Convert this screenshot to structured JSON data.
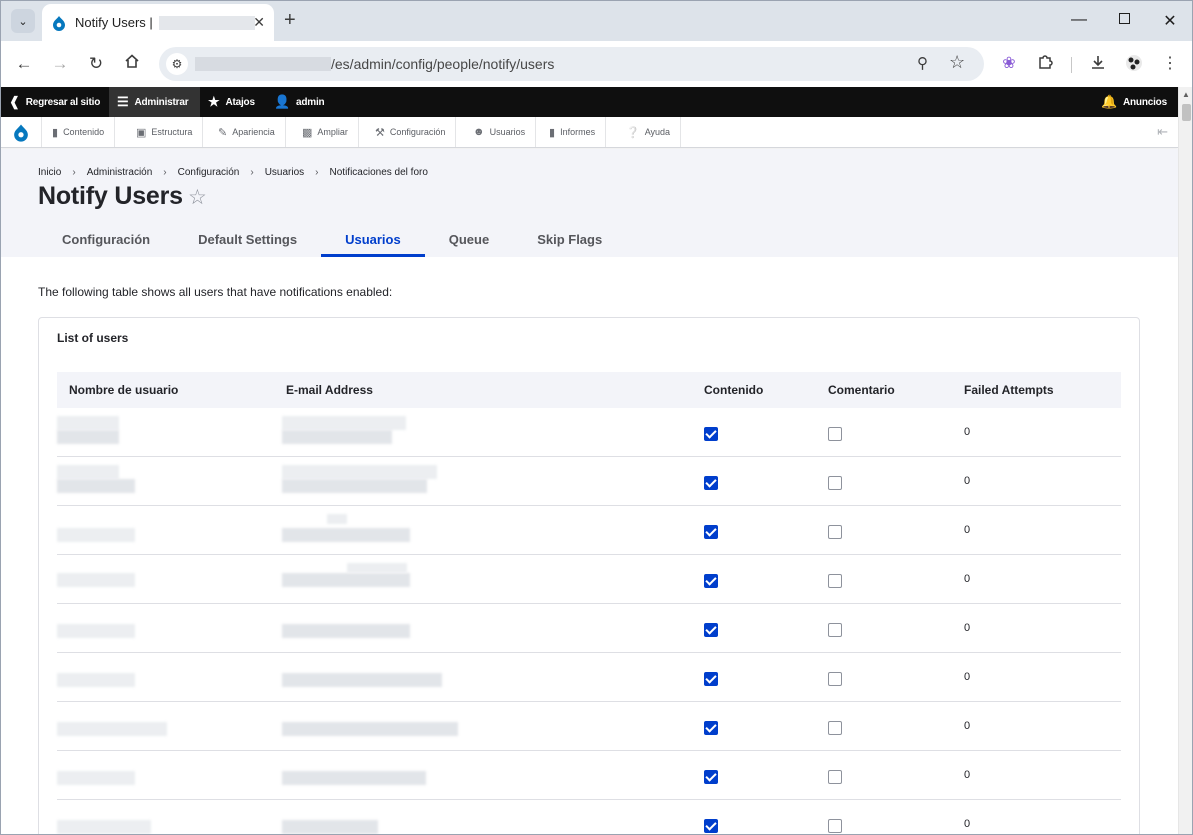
{
  "browser": {
    "tab_title": "Notify Users |",
    "url_path": "/es/admin/config/people/notify/users"
  },
  "toolbar": {
    "back_to_site": "Regresar al sitio",
    "manage": "Administrar",
    "shortcuts": "Atajos",
    "user": "admin",
    "announcements": "Anuncios"
  },
  "tray": {
    "items": [
      {
        "label": "Contenido",
        "icon": "file-icon"
      },
      {
        "label": "Estructura",
        "icon": "sitemap-icon"
      },
      {
        "label": "Apariencia",
        "icon": "paintbrush-icon"
      },
      {
        "label": "Ampliar",
        "icon": "puzzle-icon"
      },
      {
        "label": "Configuración",
        "icon": "wrench-icon"
      },
      {
        "label": "Usuarios",
        "icon": "people-icon"
      },
      {
        "label": "Informes",
        "icon": "bar-chart-icon"
      },
      {
        "label": "Ayuda",
        "icon": "help-icon"
      }
    ]
  },
  "breadcrumb": [
    "Inicio",
    "Administración",
    "Configuración",
    "Usuarios",
    "Notificaciones del foro"
  ],
  "page": {
    "title": "Notify Users",
    "tabs": [
      "Configuración",
      "Default Settings",
      "Usuarios",
      "Queue",
      "Skip Flags"
    ],
    "active_tab": "Usuarios",
    "intro": "The following table shows all users that have notifications enabled:"
  },
  "panel": {
    "title": "List of users",
    "headers": [
      "Nombre de usuario",
      "E-mail Address",
      "Contenido",
      "Comentario",
      "Failed Attempts"
    ]
  },
  "rows": [
    {
      "contenido": true,
      "comentario": false,
      "failed": "0"
    },
    {
      "contenido": true,
      "comentario": false,
      "failed": "0"
    },
    {
      "contenido": true,
      "comentario": false,
      "failed": "0"
    },
    {
      "contenido": true,
      "comentario": false,
      "failed": "0"
    },
    {
      "contenido": true,
      "comentario": false,
      "failed": "0"
    },
    {
      "contenido": true,
      "comentario": false,
      "failed": "0"
    },
    {
      "contenido": true,
      "comentario": false,
      "failed": "0"
    },
    {
      "contenido": true,
      "comentario": false,
      "failed": "0"
    },
    {
      "contenido": true,
      "comentario": false,
      "failed": "0"
    }
  ],
  "colors": {
    "accent": "#003ecc",
    "toolbar_bg": "#0f0f0f",
    "header_bg": "#f3f4f9"
  }
}
